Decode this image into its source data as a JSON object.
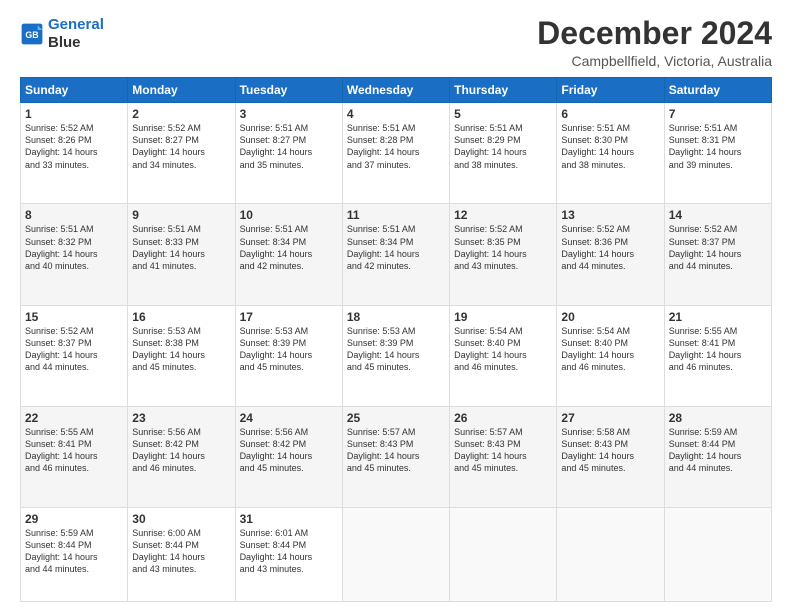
{
  "logo": {
    "line1": "General",
    "line2": "Blue"
  },
  "title": "December 2024",
  "subtitle": "Campbellfield, Victoria, Australia",
  "headers": [
    "Sunday",
    "Monday",
    "Tuesday",
    "Wednesday",
    "Thursday",
    "Friday",
    "Saturday"
  ],
  "weeks": [
    [
      {
        "day": "1",
        "sunrise": "5:52 AM",
        "sunset": "8:26 PM",
        "daylight": "14 hours and 33 minutes."
      },
      {
        "day": "2",
        "sunrise": "5:52 AM",
        "sunset": "8:27 PM",
        "daylight": "14 hours and 34 minutes."
      },
      {
        "day": "3",
        "sunrise": "5:51 AM",
        "sunset": "8:27 PM",
        "daylight": "14 hours and 35 minutes."
      },
      {
        "day": "4",
        "sunrise": "5:51 AM",
        "sunset": "8:28 PM",
        "daylight": "14 hours and 37 minutes."
      },
      {
        "day": "5",
        "sunrise": "5:51 AM",
        "sunset": "8:29 PM",
        "daylight": "14 hours and 38 minutes."
      },
      {
        "day": "6",
        "sunrise": "5:51 AM",
        "sunset": "8:30 PM",
        "daylight": "14 hours and 38 minutes."
      },
      {
        "day": "7",
        "sunrise": "5:51 AM",
        "sunset": "8:31 PM",
        "daylight": "14 hours and 39 minutes."
      }
    ],
    [
      {
        "day": "8",
        "sunrise": "5:51 AM",
        "sunset": "8:32 PM",
        "daylight": "14 hours and 40 minutes."
      },
      {
        "day": "9",
        "sunrise": "5:51 AM",
        "sunset": "8:33 PM",
        "daylight": "14 hours and 41 minutes."
      },
      {
        "day": "10",
        "sunrise": "5:51 AM",
        "sunset": "8:34 PM",
        "daylight": "14 hours and 42 minutes."
      },
      {
        "day": "11",
        "sunrise": "5:51 AM",
        "sunset": "8:34 PM",
        "daylight": "14 hours and 42 minutes."
      },
      {
        "day": "12",
        "sunrise": "5:52 AM",
        "sunset": "8:35 PM",
        "daylight": "14 hours and 43 minutes."
      },
      {
        "day": "13",
        "sunrise": "5:52 AM",
        "sunset": "8:36 PM",
        "daylight": "14 hours and 44 minutes."
      },
      {
        "day": "14",
        "sunrise": "5:52 AM",
        "sunset": "8:37 PM",
        "daylight": "14 hours and 44 minutes."
      }
    ],
    [
      {
        "day": "15",
        "sunrise": "5:52 AM",
        "sunset": "8:37 PM",
        "daylight": "14 hours and 44 minutes."
      },
      {
        "day": "16",
        "sunrise": "5:53 AM",
        "sunset": "8:38 PM",
        "daylight": "14 hours and 45 minutes."
      },
      {
        "day": "17",
        "sunrise": "5:53 AM",
        "sunset": "8:39 PM",
        "daylight": "14 hours and 45 minutes."
      },
      {
        "day": "18",
        "sunrise": "5:53 AM",
        "sunset": "8:39 PM",
        "daylight": "14 hours and 45 minutes."
      },
      {
        "day": "19",
        "sunrise": "5:54 AM",
        "sunset": "8:40 PM",
        "daylight": "14 hours and 46 minutes."
      },
      {
        "day": "20",
        "sunrise": "5:54 AM",
        "sunset": "8:40 PM",
        "daylight": "14 hours and 46 minutes."
      },
      {
        "day": "21",
        "sunrise": "5:55 AM",
        "sunset": "8:41 PM",
        "daylight": "14 hours and 46 minutes."
      }
    ],
    [
      {
        "day": "22",
        "sunrise": "5:55 AM",
        "sunset": "8:41 PM",
        "daylight": "14 hours and 46 minutes."
      },
      {
        "day": "23",
        "sunrise": "5:56 AM",
        "sunset": "8:42 PM",
        "daylight": "14 hours and 46 minutes."
      },
      {
        "day": "24",
        "sunrise": "5:56 AM",
        "sunset": "8:42 PM",
        "daylight": "14 hours and 45 minutes."
      },
      {
        "day": "25",
        "sunrise": "5:57 AM",
        "sunset": "8:43 PM",
        "daylight": "14 hours and 45 minutes."
      },
      {
        "day": "26",
        "sunrise": "5:57 AM",
        "sunset": "8:43 PM",
        "daylight": "14 hours and 45 minutes."
      },
      {
        "day": "27",
        "sunrise": "5:58 AM",
        "sunset": "8:43 PM",
        "daylight": "14 hours and 45 minutes."
      },
      {
        "day": "28",
        "sunrise": "5:59 AM",
        "sunset": "8:44 PM",
        "daylight": "14 hours and 44 minutes."
      }
    ],
    [
      {
        "day": "29",
        "sunrise": "5:59 AM",
        "sunset": "8:44 PM",
        "daylight": "14 hours and 44 minutes."
      },
      {
        "day": "30",
        "sunrise": "6:00 AM",
        "sunset": "8:44 PM",
        "daylight": "14 hours and 43 minutes."
      },
      {
        "day": "31",
        "sunrise": "6:01 AM",
        "sunset": "8:44 PM",
        "daylight": "14 hours and 43 minutes."
      },
      null,
      null,
      null,
      null
    ]
  ],
  "labels": {
    "sunrise": "Sunrise:",
    "sunset": "Sunset:",
    "daylight": "Daylight:"
  }
}
